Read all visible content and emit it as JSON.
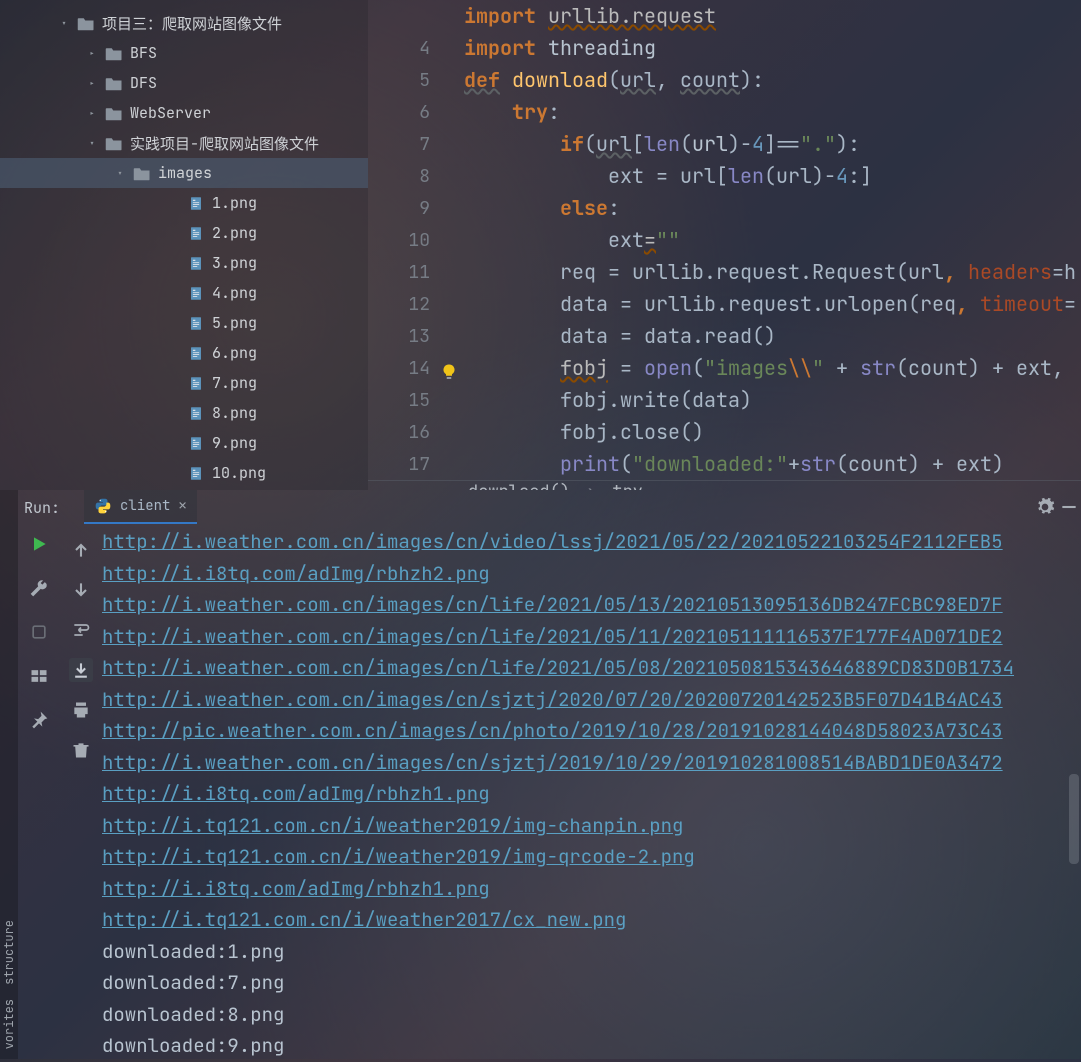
{
  "sidebar": {
    "tree": [
      {
        "indent": 52,
        "arrow": "down",
        "type": "folder",
        "label": "项目三：爬取网站图像文件"
      },
      {
        "indent": 80,
        "arrow": "right",
        "type": "folder",
        "label": "BFS"
      },
      {
        "indent": 80,
        "arrow": "right",
        "type": "folder",
        "label": "DFS"
      },
      {
        "indent": 80,
        "arrow": "right",
        "type": "folder",
        "label": "WebServer"
      },
      {
        "indent": 80,
        "arrow": "down",
        "type": "folder",
        "label": "实践项目-爬取网站图像文件"
      },
      {
        "indent": 108,
        "arrow": "down",
        "type": "folder",
        "label": "images",
        "selected": true
      },
      {
        "indent": 162,
        "arrow": "none",
        "type": "file",
        "label": "1.png"
      },
      {
        "indent": 162,
        "arrow": "none",
        "type": "file",
        "label": "2.png"
      },
      {
        "indent": 162,
        "arrow": "none",
        "type": "file",
        "label": "3.png"
      },
      {
        "indent": 162,
        "arrow": "none",
        "type": "file",
        "label": "4.png"
      },
      {
        "indent": 162,
        "arrow": "none",
        "type": "file",
        "label": "5.png"
      },
      {
        "indent": 162,
        "arrow": "none",
        "type": "file",
        "label": "6.png"
      },
      {
        "indent": 162,
        "arrow": "none",
        "type": "file",
        "label": "7.png"
      },
      {
        "indent": 162,
        "arrow": "none",
        "type": "file",
        "label": "8.png"
      },
      {
        "indent": 162,
        "arrow": "none",
        "type": "file",
        "label": "9.png"
      },
      {
        "indent": 162,
        "arrow": "none",
        "type": "file",
        "label": "10.png"
      }
    ]
  },
  "editor": {
    "lines": [
      {
        "n": "",
        "tokens": [
          {
            "t": "import",
            "c": "kw"
          },
          {
            "t": " "
          },
          {
            "t": "urllib.request",
            "c": "warn"
          }
        ]
      },
      {
        "n": "4",
        "tokens": [
          {
            "t": "import",
            "c": "kw"
          },
          {
            "t": " "
          },
          {
            "t": "threading",
            "c": "plain"
          }
        ]
      },
      {
        "n": "5",
        "tokens": [
          {
            "t": "def",
            "c": "kw-u"
          },
          {
            "t": " "
          },
          {
            "t": "download",
            "c": "fn"
          },
          {
            "t": "("
          },
          {
            "t": "url",
            "c": "param"
          },
          {
            "t": ", "
          },
          {
            "t": "count",
            "c": "param"
          },
          {
            "t": "):"
          }
        ]
      },
      {
        "n": "6",
        "tokens": [
          {
            "t": "    "
          },
          {
            "t": "try",
            "c": "kw"
          },
          {
            "t": ":"
          }
        ]
      },
      {
        "n": "7",
        "tokens": [
          {
            "t": "        "
          },
          {
            "t": "if",
            "c": "kw"
          },
          {
            "t": "("
          },
          {
            "t": "url",
            "c": "param"
          },
          {
            "t": "["
          },
          {
            "t": "len",
            "c": "builtin"
          },
          {
            "t": "("
          },
          {
            "t": "url",
            "c": "plain"
          },
          {
            "t": ")-"
          },
          {
            "t": "4",
            "c": "num"
          },
          {
            "t": "]"
          },
          {
            "t": "=="
          },
          {
            "t": "\".\"",
            "c": "str"
          },
          {
            "t": "):"
          }
        ]
      },
      {
        "n": "8",
        "tokens": [
          {
            "t": "            "
          },
          {
            "t": "ext = url["
          },
          {
            "t": "len",
            "c": "builtin"
          },
          {
            "t": "(url)-"
          },
          {
            "t": "4",
            "c": "num"
          },
          {
            "t": ":]"
          }
        ]
      },
      {
        "n": "9",
        "tokens": [
          {
            "t": "        "
          },
          {
            "t": "else",
            "c": "kw"
          },
          {
            "t": ":"
          }
        ]
      },
      {
        "n": "10",
        "tokens": [
          {
            "t": "            "
          },
          {
            "t": "ext"
          },
          {
            "t": "=",
            "c": "warn"
          },
          {
            "t": "\"\"",
            "c": "str"
          }
        ]
      },
      {
        "n": "11",
        "tokens": [
          {
            "t": "        "
          },
          {
            "t": "req = urllib.request.Request(url"
          },
          {
            "t": ",",
            "c": "kw"
          },
          {
            "t": " "
          },
          {
            "t": "headers",
            "c": "kwarg"
          },
          {
            "t": "=h"
          }
        ]
      },
      {
        "n": "12",
        "tokens": [
          {
            "t": "        "
          },
          {
            "t": "data = urllib.request.urlopen(req"
          },
          {
            "t": ",",
            "c": "kw"
          },
          {
            "t": " "
          },
          {
            "t": "timeout",
            "c": "kwarg"
          },
          {
            "t": "="
          }
        ]
      },
      {
        "n": "13",
        "tokens": [
          {
            "t": "        "
          },
          {
            "t": "data = data.read()"
          }
        ]
      },
      {
        "n": "14",
        "bulb": true,
        "tokens": [
          {
            "t": "        "
          },
          {
            "t": "fobj",
            "c": "warn"
          },
          {
            "t": " = "
          },
          {
            "t": "open",
            "c": "builtin"
          },
          {
            "t": "("
          },
          {
            "t": "\"images",
            "c": "str"
          },
          {
            "t": "\\\\",
            "c": "esc"
          },
          {
            "t": "\"",
            "c": "str"
          },
          {
            "t": " + "
          },
          {
            "t": "str",
            "c": "builtin"
          },
          {
            "t": "(count) + ext,"
          }
        ]
      },
      {
        "n": "15",
        "tokens": [
          {
            "t": "        "
          },
          {
            "t": "fobj.write(data)"
          }
        ]
      },
      {
        "n": "16",
        "tokens": [
          {
            "t": "        "
          },
          {
            "t": "fobj.close()"
          }
        ]
      },
      {
        "n": "17",
        "tokens": [
          {
            "t": "        "
          },
          {
            "t": "print",
            "c": "builtin"
          },
          {
            "t": "("
          },
          {
            "t": "\"downloaded:\"",
            "c": "str"
          },
          {
            "t": "+"
          },
          {
            "t": "str",
            "c": "builtin"
          },
          {
            "t": "(count) + ext)"
          }
        ]
      }
    ],
    "crumb": {
      "a": "download()",
      "b": "try"
    }
  },
  "run": {
    "label": "Run:",
    "tab": "client",
    "output": [
      {
        "type": "link",
        "text": "http://i.weather.com.cn/images/cn/video/lssj/2021/05/22/20210522103254F2112FEB5"
      },
      {
        "type": "link",
        "text": "http://i.i8tq.com/adImg/rbhzh2.png"
      },
      {
        "type": "link",
        "text": "http://i.weather.com.cn/images/cn/life/2021/05/13/20210513095136DB247FCBC98ED7F"
      },
      {
        "type": "link",
        "text": "http://i.weather.com.cn/images/cn/life/2021/05/11/202105111116537F177F4AD071DE2"
      },
      {
        "type": "link",
        "text": "http://i.weather.com.cn/images/cn/life/2021/05/08/2021050815343646889CD83D0B1734"
      },
      {
        "type": "link",
        "text": "http://i.weather.com.cn/images/cn/sjztj/2020/07/20/20200720142523B5F07D41B4AC43"
      },
      {
        "type": "link",
        "text": "http://pic.weather.com.cn/images/cn/photo/2019/10/28/20191028144048D58023A73C43"
      },
      {
        "type": "link",
        "text": "http://i.weather.com.cn/images/cn/sjztj/2019/10/29/201910281008514BABD1DE0A3472"
      },
      {
        "type": "link",
        "text": "http://i.i8tq.com/adImg/rbhzh1.png"
      },
      {
        "type": "link",
        "text": "http://i.tq121.com.cn/i/weather2019/img-chanpin.png"
      },
      {
        "type": "link",
        "text": "http://i.tq121.com.cn/i/weather2019/img-qrcode-2.png"
      },
      {
        "type": "link",
        "text": "http://i.i8tq.com/adImg/rbhzh1.png"
      },
      {
        "type": "link",
        "text": "http://i.tq121.com.cn/i/weather2017/cx_new.png"
      },
      {
        "type": "text",
        "text": "downloaded:1.png"
      },
      {
        "type": "text",
        "text": "downloaded:7.png"
      },
      {
        "type": "text",
        "text": "downloaded:8.png"
      },
      {
        "type": "text",
        "text": "downloaded:9.png"
      }
    ]
  },
  "leftStrip": {
    "a": "structure",
    "b": "vorites"
  }
}
